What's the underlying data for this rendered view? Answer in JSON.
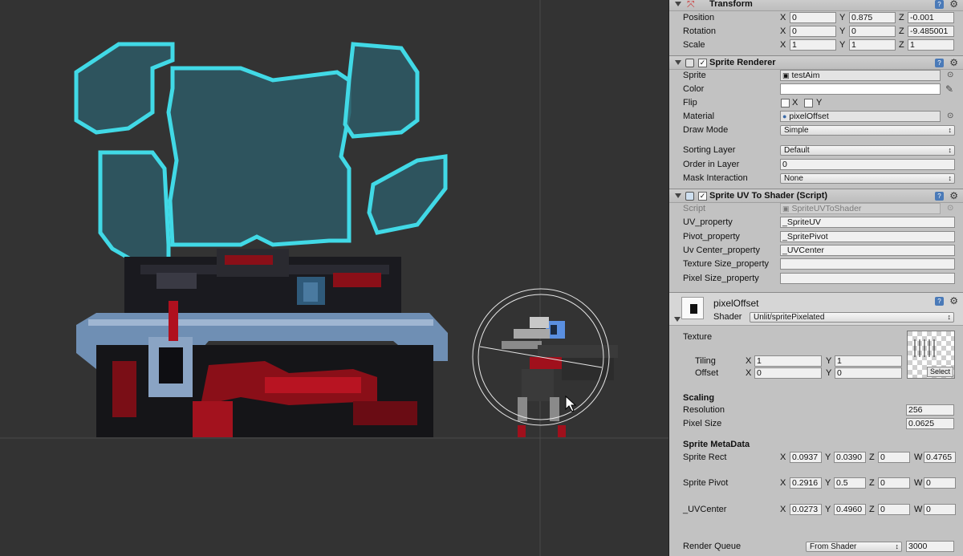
{
  "transform": {
    "title": "Transform",
    "position": {
      "label": "Position",
      "x": "0",
      "y": "0.875",
      "z": "-0.001"
    },
    "rotation": {
      "label": "Rotation",
      "x": "0",
      "y": "0",
      "z": "-9.485001"
    },
    "scale": {
      "label": "Scale",
      "x": "1",
      "y": "1",
      "z": "1"
    },
    "axis_x": "X",
    "axis_y": "Y",
    "axis_z": "Z"
  },
  "sprite_renderer": {
    "title": "Sprite Renderer",
    "sprite_label": "Sprite",
    "sprite_value": "testAim",
    "color_label": "Color",
    "flip_label": "Flip",
    "flip_x": "X",
    "flip_y": "Y",
    "material_label": "Material",
    "material_value": "pixelOffset",
    "draw_mode_label": "Draw Mode",
    "draw_mode_value": "Simple",
    "sorting_layer_label": "Sorting Layer",
    "sorting_layer_value": "Default",
    "order_label": "Order in Layer",
    "order_value": "0",
    "mask_label": "Mask Interaction",
    "mask_value": "None"
  },
  "sprite_uv": {
    "title": "Sprite UV To Shader (Script)",
    "script_label": "Script",
    "script_value": "SpriteUVToShader",
    "uv_label": "UV_property",
    "uv_value": "_SpriteUV",
    "pivot_label": "Pivot_property",
    "pivot_value": "_SpritePivot",
    "uvcenter_label": "Uv Center_property",
    "uvcenter_value": "_UVCenter",
    "texsize_label": "Texture Size_property",
    "texsize_value": "",
    "pixsize_label": "Pixel Size_property",
    "pixsize_value": ""
  },
  "material": {
    "name": "pixelOffset",
    "shader_label": "Shader",
    "shader_value": "Unlit/spritePixelated",
    "texture_label": "Texture",
    "tiling_label": "Tiling",
    "tiling_x": "1",
    "tiling_y": "1",
    "offset_label": "Offset",
    "offset_x": "0",
    "offset_y": "0",
    "select_label": "Select",
    "scaling_title": "Scaling",
    "resolution_label": "Resolution",
    "resolution_value": "256",
    "pixel_size_label": "Pixel Size",
    "pixel_size_value": "0.0625",
    "meta_title": "Sprite MetaData",
    "rect_label": "Sprite Rect",
    "rect_x": "0.0937",
    "rect_y": "0.0390",
    "rect_z": "0",
    "rect_w": "0.4765",
    "pivot_label": "Sprite Pivot",
    "pivot_x": "0.2916",
    "pivot_y": "0.5",
    "pivot_z": "0",
    "pivot_w": "0",
    "uvc_label": "_UVCenter",
    "uvc_x": "0.0273",
    "uvc_y": "0.4960",
    "uvc_z": "0",
    "uvc_w": "0",
    "axis_w": "W",
    "render_queue_label": "Render Queue",
    "render_queue_mode": "From Shader",
    "render_queue_value": "3000"
  },
  "colors": {
    "scene_bg": "#333333",
    "inspector_bg": "#c2c2c2",
    "shield_stroke": "#41d9e6",
    "shield_fill": "#2e5a66",
    "tank_blue": "#6f8fb4",
    "tank_dark": "#1a1a1f",
    "tank_red": "#a0101c"
  }
}
